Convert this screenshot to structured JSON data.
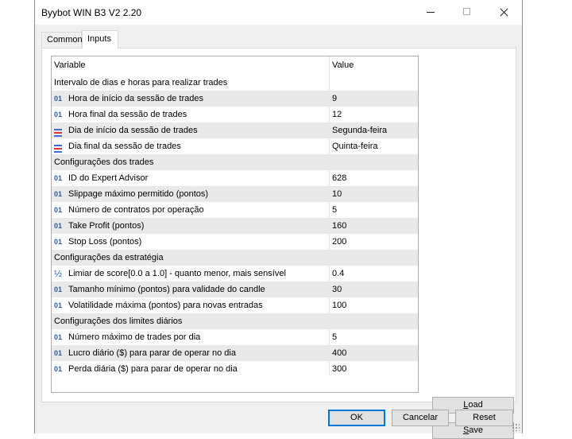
{
  "window": {
    "title": "Byybot WIN B3 V2 2.20"
  },
  "tabs": [
    {
      "label": "Common"
    },
    {
      "label": "Inputs"
    }
  ],
  "table": {
    "columns": {
      "variable": "Variable",
      "value": "Value"
    },
    "rows": [
      {
        "icon": "",
        "label": "Intervalo de dias e horas para realizar trades",
        "value": "",
        "group": true
      },
      {
        "icon": "int-icon",
        "label": "Hora de início da sessão de trades",
        "value": "9"
      },
      {
        "icon": "int-icon",
        "label": "Hora final da sessão de trades",
        "value": "12"
      },
      {
        "icon": "enum-icon",
        "label": "Dia de início da sessão de trades",
        "value": "Segunda-feira"
      },
      {
        "icon": "enum-icon",
        "label": "Dia final da sessão de trades",
        "value": "Quinta-feira"
      },
      {
        "icon": "",
        "label": "Configurações dos trades",
        "value": "",
        "group": true
      },
      {
        "icon": "int-icon",
        "label": "ID do Expert Advisor",
        "value": "628"
      },
      {
        "icon": "int-icon",
        "label": "Slippage máximo permitido (pontos)",
        "value": "10"
      },
      {
        "icon": "int-icon",
        "label": "Número de contratos por operação",
        "value": "5"
      },
      {
        "icon": "int-icon",
        "label": "Take Profit (pontos)",
        "value": "160"
      },
      {
        "icon": "int-icon",
        "label": "Stop Loss (pontos)",
        "value": "200"
      },
      {
        "icon": "",
        "label": "Configurações da estratégia",
        "value": "",
        "group": true
      },
      {
        "icon": "double-icon",
        "label": "Limiar de score[0.0 a 1.0] - quanto menor, mais sensível",
        "value": "0.4"
      },
      {
        "icon": "int-icon",
        "label": "Tamanho mínimo (pontos) para validade do candle",
        "value": "30"
      },
      {
        "icon": "int-icon",
        "label": "Volatilidade máxima (pontos) para novas entradas",
        "value": "100"
      },
      {
        "icon": "",
        "label": "Configurações dos limites diários",
        "value": "",
        "group": true
      },
      {
        "icon": "int-icon",
        "label": "Número máximo de trades por dia",
        "value": "5"
      },
      {
        "icon": "int-icon",
        "label": "Lucro diário ($) para parar de operar no dia",
        "value": "400"
      },
      {
        "icon": "int-icon",
        "label": "Perda diária ($) para parar de operar no dia",
        "value": "300"
      }
    ]
  },
  "icon_glyphs": {
    "int": "01",
    "double": "½"
  },
  "buttons": {
    "load_prefix": "",
    "load_key": "L",
    "load_rest": "oad",
    "save_prefix": "",
    "save_key": "S",
    "save_rest": "ave",
    "ok": "OK",
    "cancel": "Cancelar",
    "reset": "Reset"
  }
}
